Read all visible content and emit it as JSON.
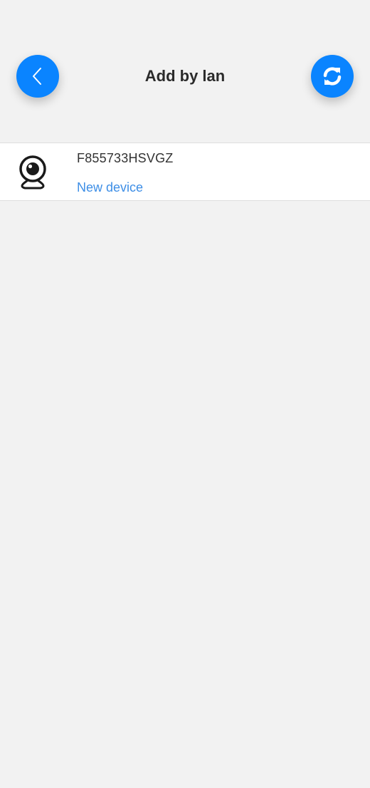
{
  "header": {
    "title": "Add by lan",
    "back_icon": "chevron-left-icon",
    "refresh_icon": "refresh-icon"
  },
  "devices": [
    {
      "id": "F855733HSVGZ",
      "status": "New device",
      "icon": "camera-icon"
    }
  ],
  "colors": {
    "accent": "#0a84ff",
    "status_text": "#3d8ee6",
    "background": "#f2f2f2"
  }
}
